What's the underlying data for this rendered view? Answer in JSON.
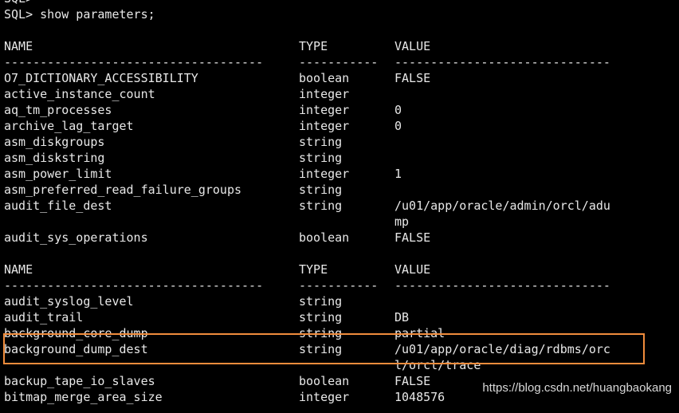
{
  "terminal": {
    "prev_prompt": "SQL>",
    "command": "SQL> show parameters;",
    "headers": {
      "name": "NAME",
      "type": "TYPE",
      "value": "VALUE"
    },
    "separators": {
      "name": "------------------------------------",
      "type": "-----------",
      "value": "------------------------------"
    },
    "rows_block1": [
      {
        "name": "O7_DICTIONARY_ACCESSIBILITY",
        "type": "boolean",
        "value": "FALSE",
        "value2": ""
      },
      {
        "name": "active_instance_count",
        "type": "integer",
        "value": "",
        "value2": ""
      },
      {
        "name": "aq_tm_processes",
        "type": "integer",
        "value": "0",
        "value2": ""
      },
      {
        "name": "archive_lag_target",
        "type": "integer",
        "value": "0",
        "value2": ""
      },
      {
        "name": "asm_diskgroups",
        "type": "string",
        "value": "",
        "value2": ""
      },
      {
        "name": "asm_diskstring",
        "type": "string",
        "value": "",
        "value2": ""
      },
      {
        "name": "asm_power_limit",
        "type": "integer",
        "value": "1",
        "value2": ""
      },
      {
        "name": "asm_preferred_read_failure_groups",
        "type": "string",
        "value": "",
        "value2": ""
      },
      {
        "name": "audit_file_dest",
        "type": "string",
        "value": "/u01/app/oracle/admin/orcl/adu",
        "value2": "mp"
      },
      {
        "name": "audit_sys_operations",
        "type": "boolean",
        "value": "FALSE",
        "value2": ""
      }
    ],
    "rows_block2": [
      {
        "name": "audit_syslog_level",
        "type": "string",
        "value": "",
        "value2": ""
      },
      {
        "name": "audit_trail",
        "type": "string",
        "value": "DB",
        "value2": ""
      },
      {
        "name": "background_core_dump",
        "type": "string",
        "value": "partial",
        "value2": ""
      },
      {
        "name": "background_dump_dest",
        "type": "string",
        "value": "/u01/app/oracle/diag/rdbms/orc",
        "value2": "l/orcl/trace"
      },
      {
        "name": "backup_tape_io_slaves",
        "type": "boolean",
        "value": "FALSE",
        "value2": ""
      },
      {
        "name": "bitmap_merge_area_size",
        "type": "integer",
        "value": "1048576",
        "value2": ""
      }
    ]
  },
  "watermark": "https://blog.csdn.net/huangbaokang",
  "colors": {
    "background": "#000000",
    "text": "#e8e8e8",
    "highlight_border": "#f08c3c"
  }
}
